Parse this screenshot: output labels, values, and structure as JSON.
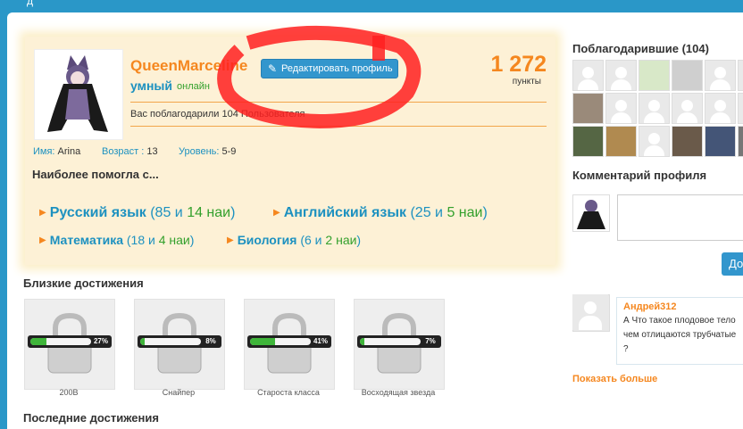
{
  "header": {
    "partial_text": "д"
  },
  "profile": {
    "username": "QueenMarceline",
    "edit_button": "Редактировать профиль",
    "rank": "умный",
    "online_status": "онлайн",
    "points_value": "1 272",
    "points_label": "пункты",
    "thanked_text": "Вас поблагодарили 104 Пользователя",
    "name_label": "Имя:",
    "name_value": "Arina",
    "age_label": "Возраст :",
    "age_value": "13",
    "level_label": "Уровень:",
    "level_value": "5-9",
    "helped_title": "Наиболее помогла с...",
    "subjects": [
      {
        "name": "Русский язык",
        "open": "(85 и",
        "best": "14 наи",
        "close": ")"
      },
      {
        "name": "Английский язык",
        "open": "(25 и",
        "best": "5 наи",
        "close": ")"
      },
      {
        "name": "Математика",
        "open": "(18 и",
        "best": "4 наи",
        "close": ")"
      },
      {
        "name": "Биология",
        "open": "(6 и",
        "best": "2 наи",
        "close": ")"
      }
    ]
  },
  "achievements_near": {
    "title": "Близкие достижения",
    "items": [
      {
        "label": "200В",
        "percent_text": "27%",
        "progress": 0.27
      },
      {
        "label": "Снайпер",
        "percent_text": "8%",
        "progress": 0.08
      },
      {
        "label": "Староста класса",
        "percent_text": "41%",
        "progress": 0.41
      },
      {
        "label": "Восходящая звезда",
        "percent_text": "7%",
        "progress": 0.07
      }
    ]
  },
  "achievements_last": {
    "title": "Последние достижения"
  },
  "sidebar": {
    "thanked_title": "Поблагодарившие (104)",
    "comment_title": "Комментарий профиля",
    "send_button": "До",
    "comment": {
      "author": "Андрей312",
      "lines": [
        "А Что такое плодовое тело",
        "чем отлицаются трубчатые",
        "?"
      ]
    },
    "show_more": "Показать больше"
  },
  "colors": {
    "accent": "#f5871f",
    "link": "#1d91c0",
    "green": "#33a02c",
    "header": "#2a97c8",
    "card": "#fdf1d6",
    "annotation": "#ff2020"
  }
}
